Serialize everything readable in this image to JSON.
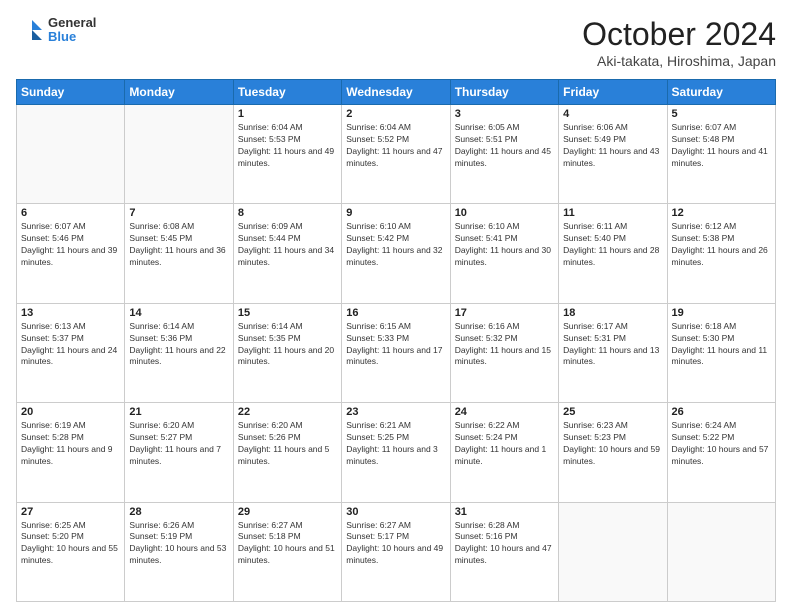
{
  "header": {
    "logo_general": "General",
    "logo_blue": "Blue",
    "month": "October 2024",
    "location": "Aki-takata, Hiroshima, Japan"
  },
  "weekdays": [
    "Sunday",
    "Monday",
    "Tuesday",
    "Wednesday",
    "Thursday",
    "Friday",
    "Saturday"
  ],
  "weeks": [
    [
      {
        "day": "",
        "info": ""
      },
      {
        "day": "",
        "info": ""
      },
      {
        "day": "1",
        "info": "Sunrise: 6:04 AM\nSunset: 5:53 PM\nDaylight: 11 hours and 49 minutes."
      },
      {
        "day": "2",
        "info": "Sunrise: 6:04 AM\nSunset: 5:52 PM\nDaylight: 11 hours and 47 minutes."
      },
      {
        "day": "3",
        "info": "Sunrise: 6:05 AM\nSunset: 5:51 PM\nDaylight: 11 hours and 45 minutes."
      },
      {
        "day": "4",
        "info": "Sunrise: 6:06 AM\nSunset: 5:49 PM\nDaylight: 11 hours and 43 minutes."
      },
      {
        "day": "5",
        "info": "Sunrise: 6:07 AM\nSunset: 5:48 PM\nDaylight: 11 hours and 41 minutes."
      }
    ],
    [
      {
        "day": "6",
        "info": "Sunrise: 6:07 AM\nSunset: 5:46 PM\nDaylight: 11 hours and 39 minutes."
      },
      {
        "day": "7",
        "info": "Sunrise: 6:08 AM\nSunset: 5:45 PM\nDaylight: 11 hours and 36 minutes."
      },
      {
        "day": "8",
        "info": "Sunrise: 6:09 AM\nSunset: 5:44 PM\nDaylight: 11 hours and 34 minutes."
      },
      {
        "day": "9",
        "info": "Sunrise: 6:10 AM\nSunset: 5:42 PM\nDaylight: 11 hours and 32 minutes."
      },
      {
        "day": "10",
        "info": "Sunrise: 6:10 AM\nSunset: 5:41 PM\nDaylight: 11 hours and 30 minutes."
      },
      {
        "day": "11",
        "info": "Sunrise: 6:11 AM\nSunset: 5:40 PM\nDaylight: 11 hours and 28 minutes."
      },
      {
        "day": "12",
        "info": "Sunrise: 6:12 AM\nSunset: 5:38 PM\nDaylight: 11 hours and 26 minutes."
      }
    ],
    [
      {
        "day": "13",
        "info": "Sunrise: 6:13 AM\nSunset: 5:37 PM\nDaylight: 11 hours and 24 minutes."
      },
      {
        "day": "14",
        "info": "Sunrise: 6:14 AM\nSunset: 5:36 PM\nDaylight: 11 hours and 22 minutes."
      },
      {
        "day": "15",
        "info": "Sunrise: 6:14 AM\nSunset: 5:35 PM\nDaylight: 11 hours and 20 minutes."
      },
      {
        "day": "16",
        "info": "Sunrise: 6:15 AM\nSunset: 5:33 PM\nDaylight: 11 hours and 17 minutes."
      },
      {
        "day": "17",
        "info": "Sunrise: 6:16 AM\nSunset: 5:32 PM\nDaylight: 11 hours and 15 minutes."
      },
      {
        "day": "18",
        "info": "Sunrise: 6:17 AM\nSunset: 5:31 PM\nDaylight: 11 hours and 13 minutes."
      },
      {
        "day": "19",
        "info": "Sunrise: 6:18 AM\nSunset: 5:30 PM\nDaylight: 11 hours and 11 minutes."
      }
    ],
    [
      {
        "day": "20",
        "info": "Sunrise: 6:19 AM\nSunset: 5:28 PM\nDaylight: 11 hours and 9 minutes."
      },
      {
        "day": "21",
        "info": "Sunrise: 6:20 AM\nSunset: 5:27 PM\nDaylight: 11 hours and 7 minutes."
      },
      {
        "day": "22",
        "info": "Sunrise: 6:20 AM\nSunset: 5:26 PM\nDaylight: 11 hours and 5 minutes."
      },
      {
        "day": "23",
        "info": "Sunrise: 6:21 AM\nSunset: 5:25 PM\nDaylight: 11 hours and 3 minutes."
      },
      {
        "day": "24",
        "info": "Sunrise: 6:22 AM\nSunset: 5:24 PM\nDaylight: 11 hours and 1 minute."
      },
      {
        "day": "25",
        "info": "Sunrise: 6:23 AM\nSunset: 5:23 PM\nDaylight: 10 hours and 59 minutes."
      },
      {
        "day": "26",
        "info": "Sunrise: 6:24 AM\nSunset: 5:22 PM\nDaylight: 10 hours and 57 minutes."
      }
    ],
    [
      {
        "day": "27",
        "info": "Sunrise: 6:25 AM\nSunset: 5:20 PM\nDaylight: 10 hours and 55 minutes."
      },
      {
        "day": "28",
        "info": "Sunrise: 6:26 AM\nSunset: 5:19 PM\nDaylight: 10 hours and 53 minutes."
      },
      {
        "day": "29",
        "info": "Sunrise: 6:27 AM\nSunset: 5:18 PM\nDaylight: 10 hours and 51 minutes."
      },
      {
        "day": "30",
        "info": "Sunrise: 6:27 AM\nSunset: 5:17 PM\nDaylight: 10 hours and 49 minutes."
      },
      {
        "day": "31",
        "info": "Sunrise: 6:28 AM\nSunset: 5:16 PM\nDaylight: 10 hours and 47 minutes."
      },
      {
        "day": "",
        "info": ""
      },
      {
        "day": "",
        "info": ""
      }
    ]
  ]
}
